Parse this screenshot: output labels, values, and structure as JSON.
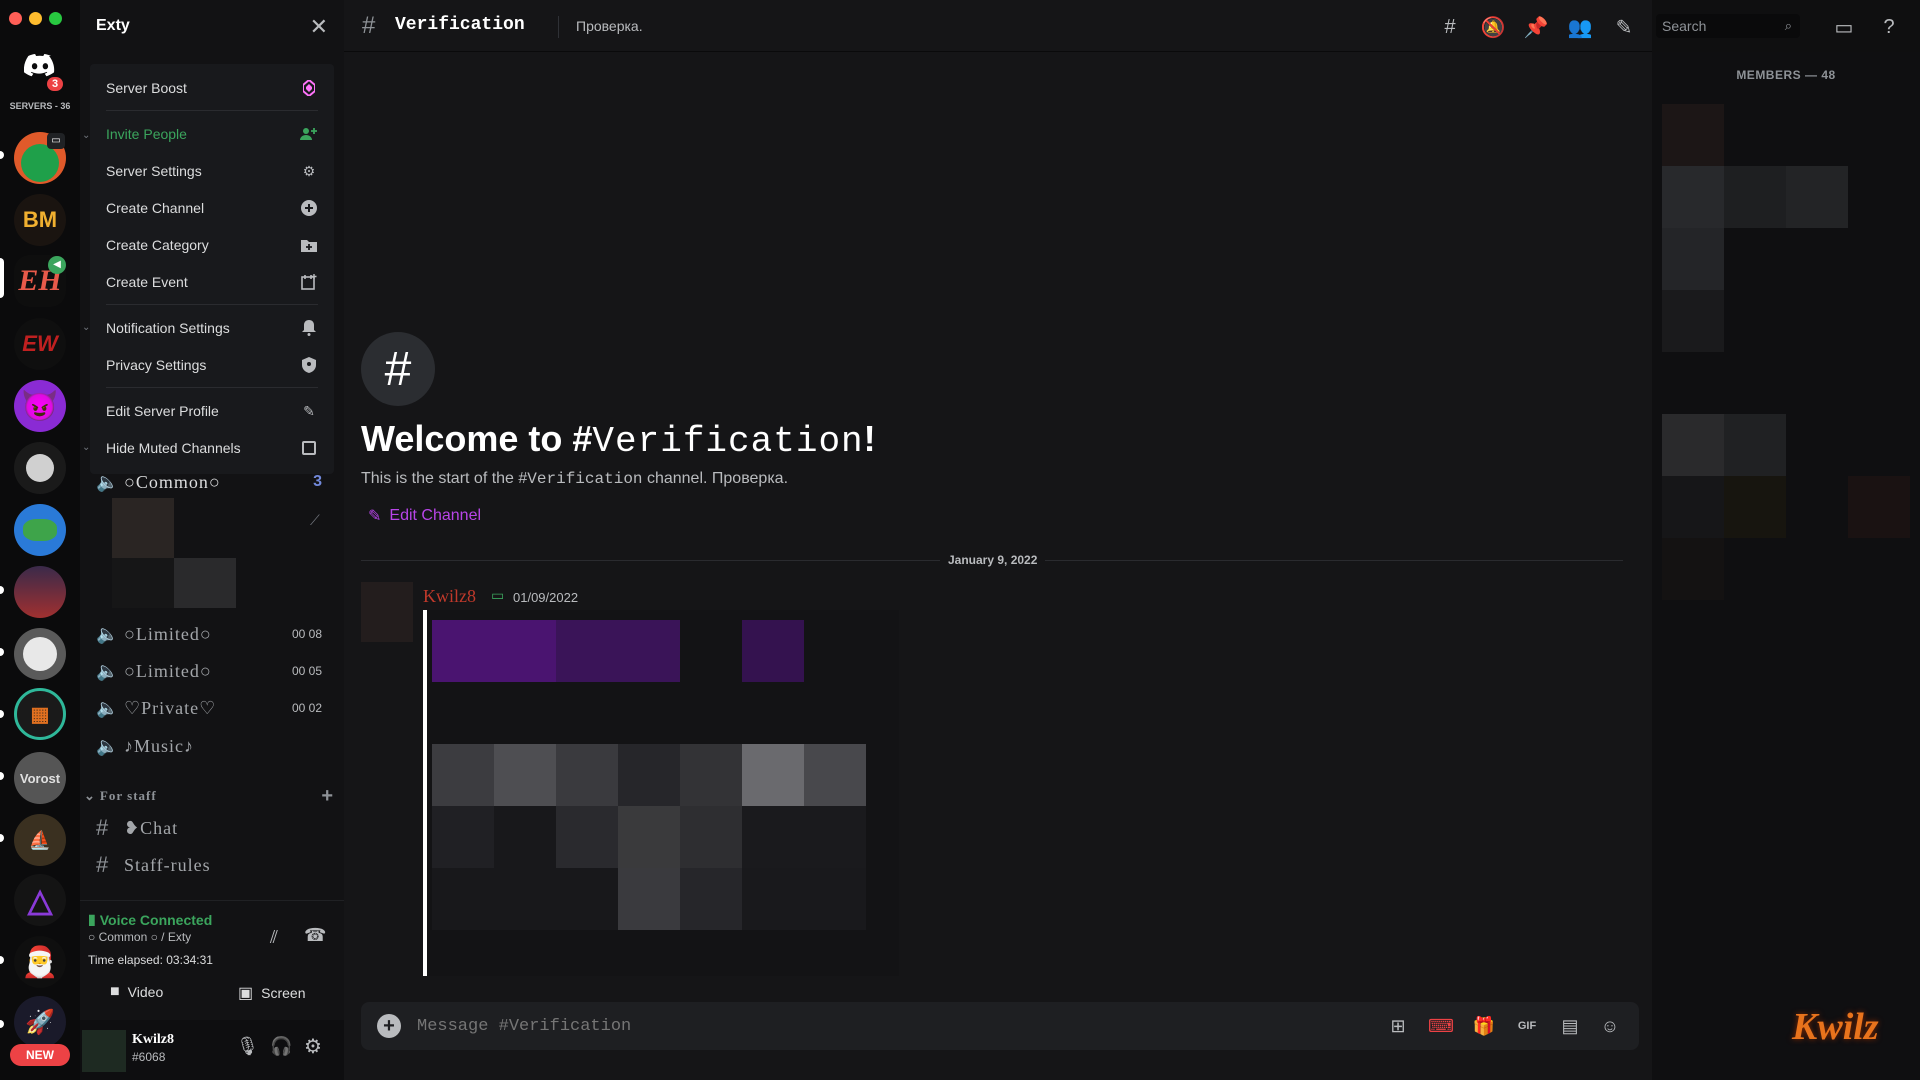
{
  "rail": {
    "servers_label": "SERVERS - 36",
    "home_badge": "3",
    "new_badge": "NEW"
  },
  "sidebar": {
    "server_name": "Exty",
    "menu": {
      "server_boost": "Server Boost",
      "invite_people": "Invite People",
      "server_settings": "Server Settings",
      "create_channel": "Create Channel",
      "create_category": "Create Category",
      "create_event": "Create Event",
      "notification_settings": "Notification Settings",
      "privacy_settings": "Privacy Settings",
      "edit_server_profile": "Edit Server Profile",
      "hide_muted_channels": "Hide Muted Channels"
    },
    "channels": [
      {
        "name": "○Common○",
        "right": "3"
      },
      {
        "name": "○Limited○",
        "right": "00 08"
      },
      {
        "name": "○Limited○",
        "right": "00 05"
      },
      {
        "name": "♡Private♡",
        "right": "00 02"
      },
      {
        "name": "♪Music♪",
        "right": ""
      }
    ],
    "category_staff": "For staff",
    "text_channels": [
      "❥Chat",
      "Staff-rules"
    ],
    "voice": {
      "status": "Voice Connected",
      "location": "○ Common ○ / Exty",
      "elapsed": "Time elapsed: 03:34:31",
      "video_label": "Video",
      "screen_label": "Screen"
    },
    "user": {
      "name": "Kwilz8",
      "tag": "#6068"
    }
  },
  "topbar": {
    "channel": "Verification",
    "topic": "Проверка.",
    "search_placeholder": "Search"
  },
  "welcome": {
    "title_prefix": "Welcome to #",
    "title_channel": "Verification",
    "title_suffix": "!",
    "sub_prefix": "This is the start of the #",
    "sub_channel": "Verification",
    "sub_suffix": " channel. Проверка.",
    "edit_channel": "Edit Channel"
  },
  "divider_date": "January 9, 2022",
  "message": {
    "author": "Kwilz8",
    "timestamp": "01/09/2022"
  },
  "composer": {
    "placeholder": "Message #Verification"
  },
  "members": {
    "header": "MEMBERS — 48"
  },
  "watermark": "Kwilz",
  "colors": {
    "accent": "#b845e8",
    "green": "#3ba55d",
    "red": "#ed4245",
    "author": "#c0392b"
  }
}
